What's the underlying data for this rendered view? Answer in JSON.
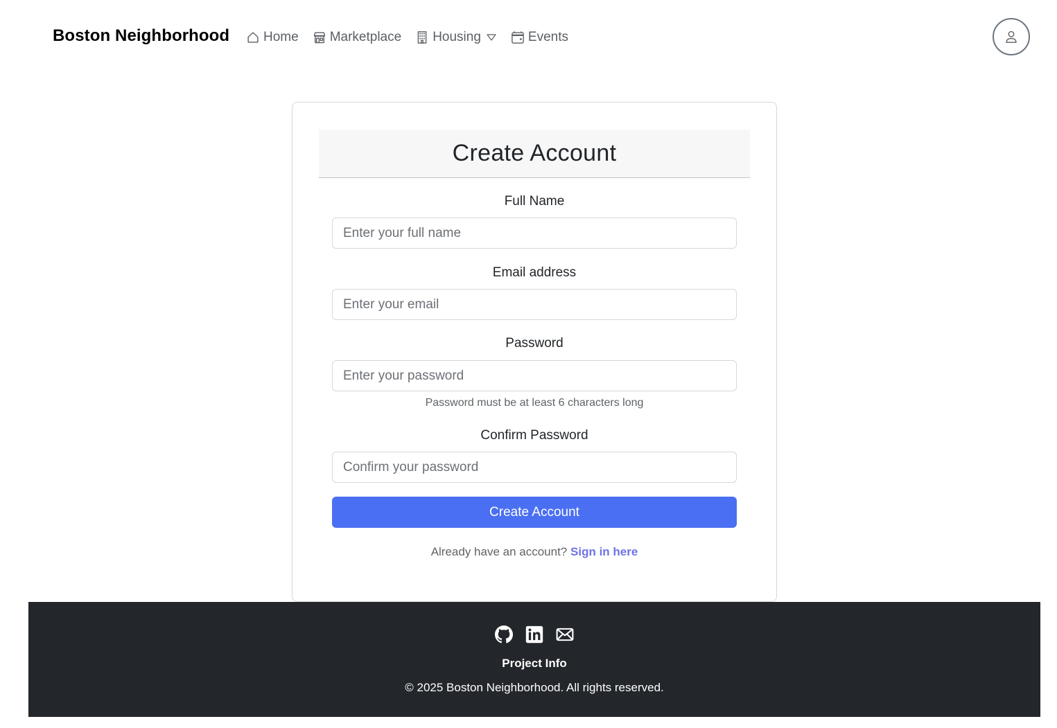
{
  "nav": {
    "brand": "Boston Neighborhood",
    "items": [
      {
        "label": "Home",
        "icon": "house-icon"
      },
      {
        "label": "Marketplace",
        "icon": "shop-icon"
      },
      {
        "label": "Housing",
        "icon": "building-icon"
      },
      {
        "label": "Events",
        "icon": "calendar-icon"
      }
    ],
    "profile_icon": "person-icon"
  },
  "form": {
    "title": "Create Account",
    "full_name_label": "Full Name",
    "full_name_placeholder": "Enter your full name",
    "email_label": "Email address",
    "email_placeholder": "Enter your email",
    "password_label": "Password",
    "password_placeholder": "Enter your password",
    "password_help": "Password must be at least 6 characters long",
    "confirm_label": "Confirm Password",
    "confirm_placeholder": "Confirm your password",
    "submit_label": "Create Account",
    "signin_prompt": "Already have an account?",
    "signin_link": "Sign in here"
  },
  "footer": {
    "icons": [
      "github-icon",
      "linkedin-icon",
      "envelope-icon"
    ],
    "project_info": "Project Info",
    "copyright": "© 2025 Boston Neighborhood. All rights reserved."
  },
  "colors": {
    "primary": "#4a6ff2",
    "link": "#6f72e6",
    "footer_bg": "#23262b"
  }
}
